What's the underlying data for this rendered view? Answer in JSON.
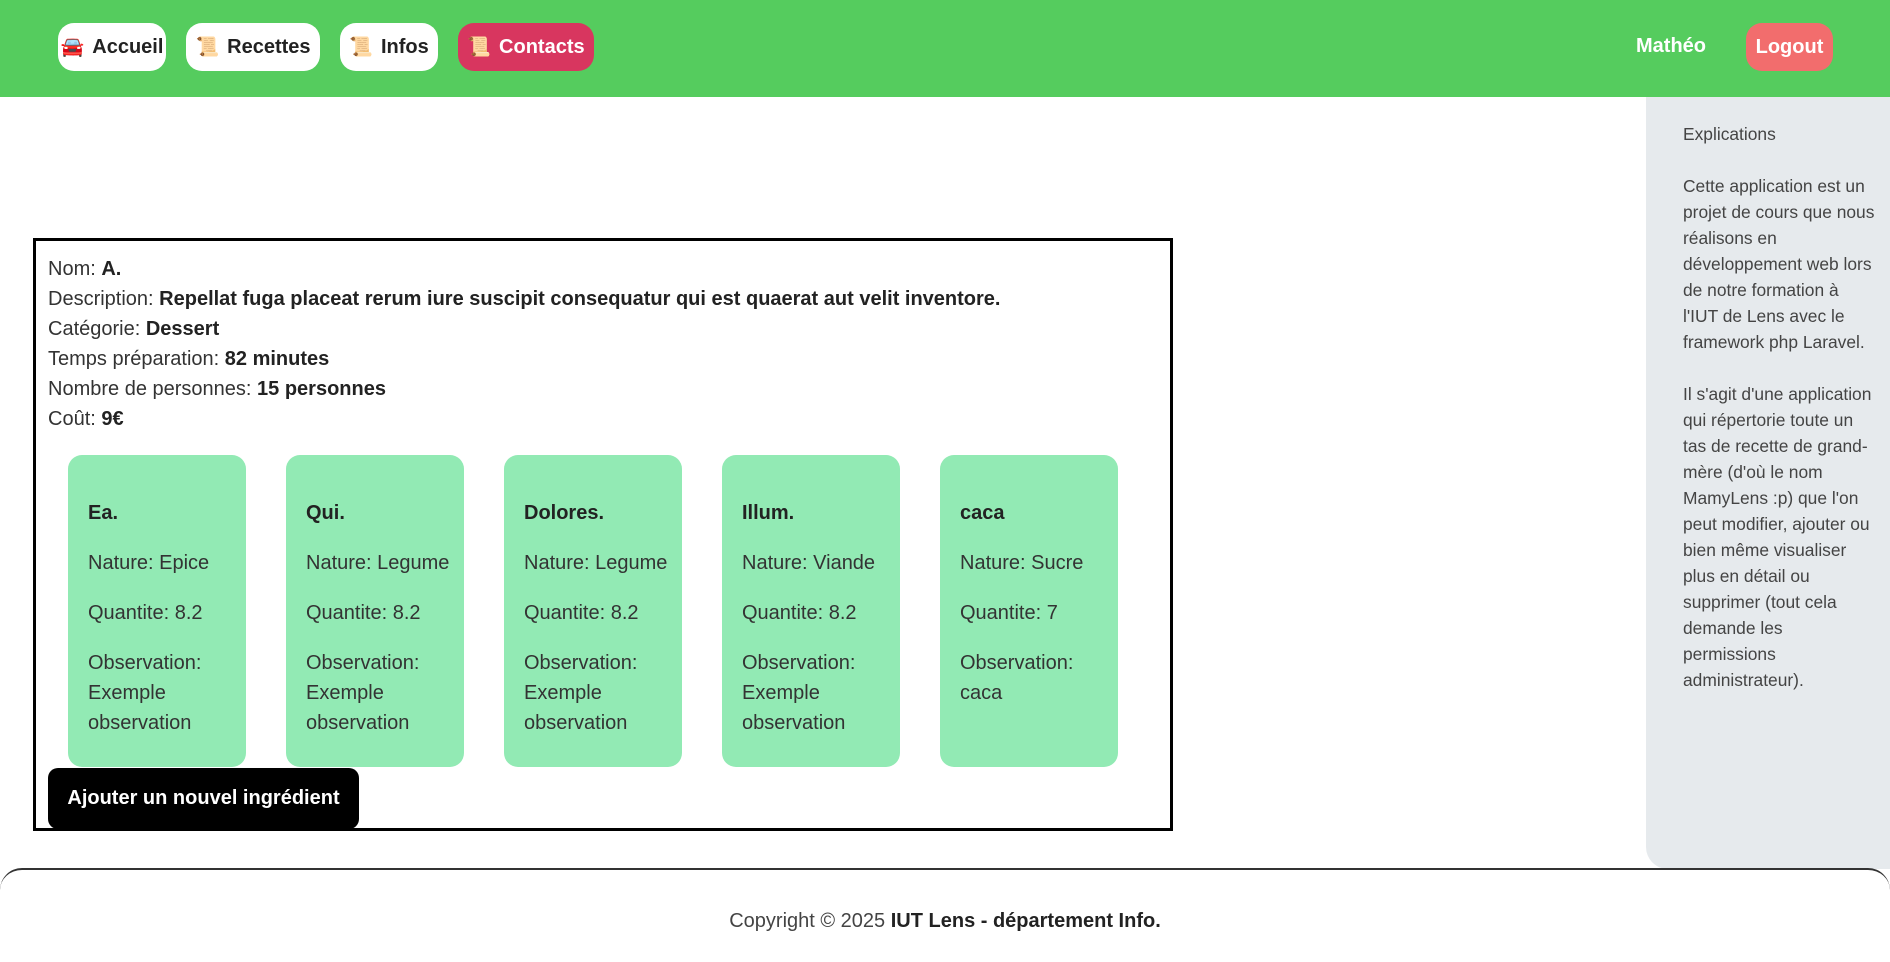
{
  "nav": {
    "items": [
      {
        "icon": "🚘",
        "label": "Accueil",
        "active": false
      },
      {
        "icon": "📜",
        "label": "Recettes",
        "active": false
      },
      {
        "icon": "📜",
        "label": "Infos",
        "active": false
      },
      {
        "icon": "📜",
        "label": "Contacts",
        "active": true
      }
    ],
    "user": "Mathéo",
    "logout": "Logout"
  },
  "sidebar": {
    "title": "Explications",
    "paragraph1": "Cette application est un projet de cours que nous réalisons en développement web lors de notre formation à l'IUT de Lens avec le framework php Laravel.",
    "paragraph2": "Il s'agit d'une application qui répertorie toute un tas de recette de grand-mère (d'où le nom MamyLens :p) que l'on peut modifier, ajouter ou bien même visualiser plus en détail ou supprimer (tout cela demande les permissions administrateur)."
  },
  "recipe": {
    "nom_label": "Nom: ",
    "nom": "A.",
    "description_label": "Description: ",
    "description": "Repellat fuga placeat rerum iure suscipit consequatur qui est quaerat aut velit inventore.",
    "categorie_label": "Catégorie: ",
    "categorie": "Dessert",
    "temps_label": "Temps préparation: ",
    "temps": "82 minutes",
    "personnes_label": "Nombre de personnes: ",
    "personnes": "15 personnes",
    "cout_label": "Coût: ",
    "cout": "9€",
    "ingredients": [
      {
        "name": "Ea.",
        "nature": "Nature: Epice",
        "quantite": "Quantite: 8.2",
        "observation": "Observation: Exemple observation"
      },
      {
        "name": "Qui.",
        "nature": "Nature: Legume",
        "quantite": "Quantite: 8.2",
        "observation": "Observation: Exemple observation"
      },
      {
        "name": "Dolores.",
        "nature": "Nature: Legume",
        "quantite": "Quantite: 8.2",
        "observation": "Observation: Exemple observation"
      },
      {
        "name": "Illum.",
        "nature": "Nature: Viande",
        "quantite": "Quantite: 8.2",
        "observation": "Observation: Exemple observation"
      },
      {
        "name": "caca",
        "nature": "Nature: Sucre",
        "quantite": "Quantite: 7",
        "observation": "Observation: caca"
      }
    ],
    "add_button": "Ajouter un nouvel ingrédient"
  },
  "footer": {
    "prefix": "Copyright © 2025 ",
    "org": "IUT Lens - département Info."
  },
  "colors": {
    "topbar": "#55cc5e",
    "active_nav": "#d8365f",
    "logout": "#f26d6d",
    "ingredient_card": "#92eab4",
    "sidebar": "#e6eaed"
  }
}
